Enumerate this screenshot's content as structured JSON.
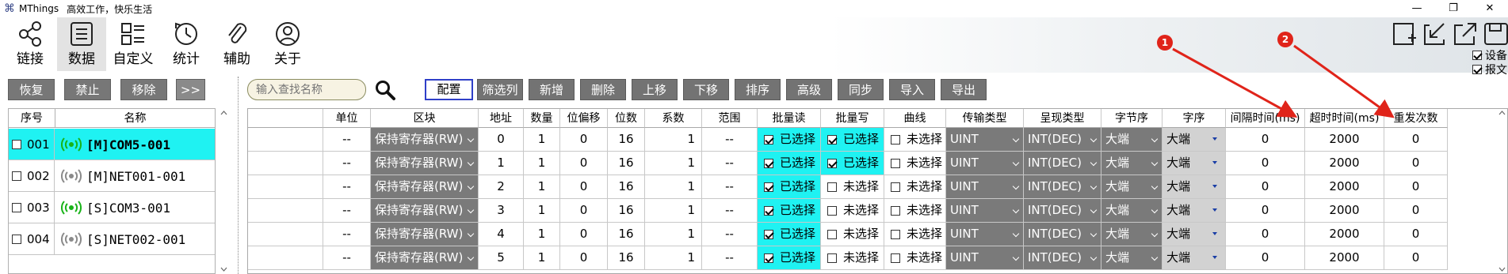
{
  "titlebar": {
    "app_name": "MThings",
    "slogan": "高效工作，快乐生活",
    "minimize": "—",
    "restore": "❐",
    "close": "✕"
  },
  "ribbon": {
    "items": [
      {
        "label": "链接",
        "icon": "share-icon"
      },
      {
        "label": "数据",
        "icon": "list-icon",
        "active": true
      },
      {
        "label": "自定义",
        "icon": "custom-layout-icon"
      },
      {
        "label": "统计",
        "icon": "clock-icon"
      },
      {
        "label": "辅助",
        "icon": "paperclip-icon"
      },
      {
        "label": "关于",
        "icon": "user-icon"
      }
    ],
    "checkboxes": [
      {
        "label": "设备",
        "checked": true
      },
      {
        "label": "报文",
        "checked": true
      }
    ],
    "markers": [
      "1",
      "2"
    ],
    "marker_color": "#e0241a"
  },
  "left_toolbar": {
    "buttons": [
      "恢复",
      "禁止",
      "移除",
      ">>"
    ]
  },
  "search": {
    "placeholder": "输入查找名称"
  },
  "toolbar": {
    "buttons": [
      "配置",
      "筛选列",
      "新增",
      "删除",
      "上移",
      "下移",
      "排序",
      "高级",
      "同步",
      "导入",
      "导出"
    ],
    "selected": "配置"
  },
  "device_list": {
    "headers": {
      "no": "序号",
      "name": "名称"
    },
    "rows": [
      {
        "no": "001",
        "name": "[M]COM5-001",
        "active": true,
        "signal": "green"
      },
      {
        "no": "002",
        "name": "[M]NET001-001",
        "active": false,
        "signal": "gray"
      },
      {
        "no": "003",
        "name": "[S]COM3-001",
        "active": false,
        "signal": "green"
      },
      {
        "no": "004",
        "name": "[S]NET002-001",
        "active": false,
        "signal": "gray"
      }
    ]
  },
  "grid": {
    "headers": [
      "",
      "单位",
      "区块",
      "地址",
      "数量",
      "位偏移",
      "位数",
      "系数",
      "范围",
      "批量读",
      "批量写",
      "曲线",
      "传输类型",
      "呈现类型",
      "字节序",
      "字序",
      "间隔时间(ms)",
      "超时时间(ms)",
      "重发次数"
    ],
    "rows": [
      {
        "unit": "--",
        "block": "保持寄存器(RW)",
        "addr": "0",
        "qty": "1",
        "bit_offset": "0",
        "bits": "16",
        "coef": "1",
        "range": "--",
        "read_label": "已选择",
        "read": true,
        "write_label": "已选择",
        "write": true,
        "curve_label": "未选择",
        "curve": false,
        "trans": "UINT",
        "present": "INT(DEC)",
        "byte_order": "大端",
        "word_order": "大端",
        "interval": "0",
        "timeout": "2000",
        "retry": "0"
      },
      {
        "unit": "--",
        "block": "保持寄存器(RW)",
        "addr": "1",
        "qty": "1",
        "bit_offset": "0",
        "bits": "16",
        "coef": "1",
        "range": "--",
        "read_label": "已选择",
        "read": true,
        "write_label": "已选择",
        "write": true,
        "curve_label": "未选择",
        "curve": false,
        "trans": "UINT",
        "present": "INT(DEC)",
        "byte_order": "大端",
        "word_order": "大端",
        "interval": "0",
        "timeout": "2000",
        "retry": "0"
      },
      {
        "unit": "--",
        "block": "保持寄存器(RW)",
        "addr": "2",
        "qty": "1",
        "bit_offset": "0",
        "bits": "16",
        "coef": "1",
        "range": "--",
        "read_label": "已选择",
        "read": true,
        "write_label": "未选择",
        "write": false,
        "curve_label": "未选择",
        "curve": false,
        "trans": "UINT",
        "present": "INT(DEC)",
        "byte_order": "大端",
        "word_order": "大端",
        "interval": "0",
        "timeout": "2000",
        "retry": "0"
      },
      {
        "unit": "--",
        "block": "保持寄存器(RW)",
        "addr": "3",
        "qty": "1",
        "bit_offset": "0",
        "bits": "16",
        "coef": "1",
        "range": "--",
        "read_label": "已选择",
        "read": true,
        "write_label": "未选择",
        "write": false,
        "curve_label": "未选择",
        "curve": false,
        "trans": "UINT",
        "present": "INT(DEC)",
        "byte_order": "大端",
        "word_order": "大端",
        "interval": "0",
        "timeout": "2000",
        "retry": "0"
      },
      {
        "unit": "--",
        "block": "保持寄存器(RW)",
        "addr": "4",
        "qty": "1",
        "bit_offset": "0",
        "bits": "16",
        "coef": "1",
        "range": "--",
        "read_label": "已选择",
        "read": true,
        "write_label": "未选择",
        "write": false,
        "curve_label": "未选择",
        "curve": false,
        "trans": "UINT",
        "present": "INT(DEC)",
        "byte_order": "大端",
        "word_order": "大端",
        "interval": "0",
        "timeout": "2000",
        "retry": "0"
      },
      {
        "unit": "--",
        "block": "保持寄存器(RW)",
        "addr": "5",
        "qty": "1",
        "bit_offset": "0",
        "bits": "16",
        "coef": "1",
        "range": "--",
        "read_label": "已选择",
        "read": true,
        "write_label": "未选择",
        "write": false,
        "curve_label": "未选择",
        "curve": false,
        "trans": "UINT",
        "present": "INT(DEC)",
        "byte_order": "大端",
        "word_order": "大端",
        "interval": "0",
        "timeout": "2000",
        "retry": "0"
      }
    ]
  },
  "colors": {
    "accent_cyan": "#1ff2f2",
    "button_gray": "#737373",
    "selected_border": "#2f3fc8",
    "signal_green": "#18b318",
    "signal_gray": "#8a8a8a"
  }
}
